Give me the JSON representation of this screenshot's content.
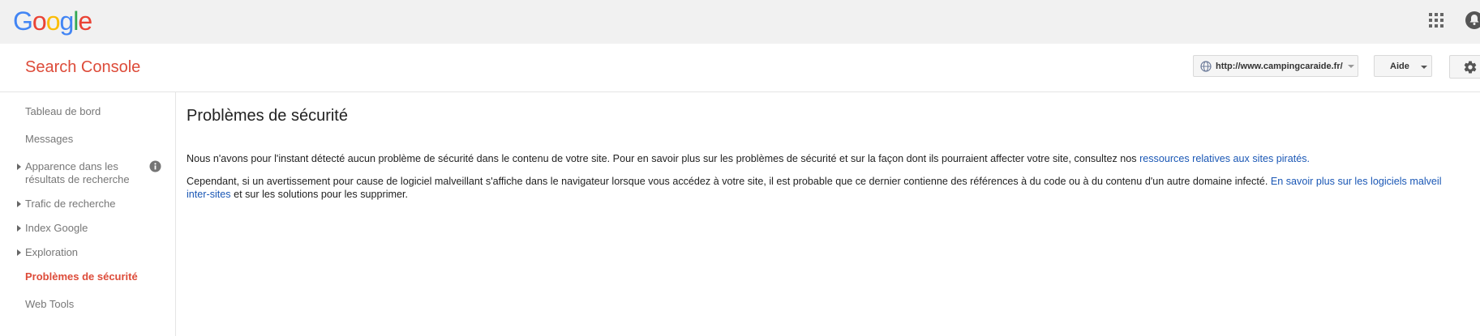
{
  "google_bar": {
    "logo_letters": [
      {
        "ch": "G",
        "color": "#4285f4"
      },
      {
        "ch": "o",
        "color": "#ea4335"
      },
      {
        "ch": "o",
        "color": "#fbbc05"
      },
      {
        "ch": "g",
        "color": "#4285f4"
      },
      {
        "ch": "l",
        "color": "#34a853"
      },
      {
        "ch": "e",
        "color": "#ea4335"
      }
    ],
    "icons": [
      "apps-grid-icon",
      "notifications-bell-icon"
    ]
  },
  "header": {
    "product_name": "Search Console",
    "site_selector": {
      "value": "http://www.campingcaraide.fr/",
      "icon": "globe-icon"
    },
    "help_button": "Aide",
    "settings_icon": "gear-icon"
  },
  "sidebar": {
    "items": [
      {
        "label": "Tableau de bord",
        "expandable": false,
        "active": false
      },
      {
        "label": "Messages",
        "expandable": false,
        "active": false
      },
      {
        "label": "Apparence dans les résultats de recherche",
        "expandable": true,
        "active": false,
        "info_icon": true
      },
      {
        "label": "Trafic de recherche",
        "expandable": true,
        "active": false
      },
      {
        "label": "Index Google",
        "expandable": true,
        "active": false
      },
      {
        "label": "Exploration",
        "expandable": true,
        "active": false
      },
      {
        "label": "Problèmes de sécurité",
        "expandable": false,
        "active": true
      },
      {
        "label": "Web Tools",
        "expandable": false,
        "active": false
      }
    ]
  },
  "main": {
    "title": "Problèmes de sécurité",
    "p1_text": "Nous n'avons pour l'instant détecté aucun problème de sécurité dans le contenu de votre site. Pour en savoir plus sur les problèmes de sécurité et sur la façon dont ils pourraient affecter votre site, consultez nos ",
    "p1_link": "ressources relatives aux sites piratés.",
    "p2_text": "Cependant, si un avertissement pour cause de logiciel malveillant s'affiche dans le navigateur lorsque vous accédez à votre site, il est probable que ce dernier contienne des références à du code ou à du contenu d'un autre domaine infecté. ",
    "p2_link_line1": "En savoir plus sur les logiciels malveil",
    "p2_link_line2": "inter-sites",
    "p2_tail": " et sur les solutions pour les supprimer."
  },
  "colors": {
    "brand_red": "#dd4b39",
    "link_blue": "#1a57b5",
    "top_bar_bg": "#f1f1f1"
  }
}
